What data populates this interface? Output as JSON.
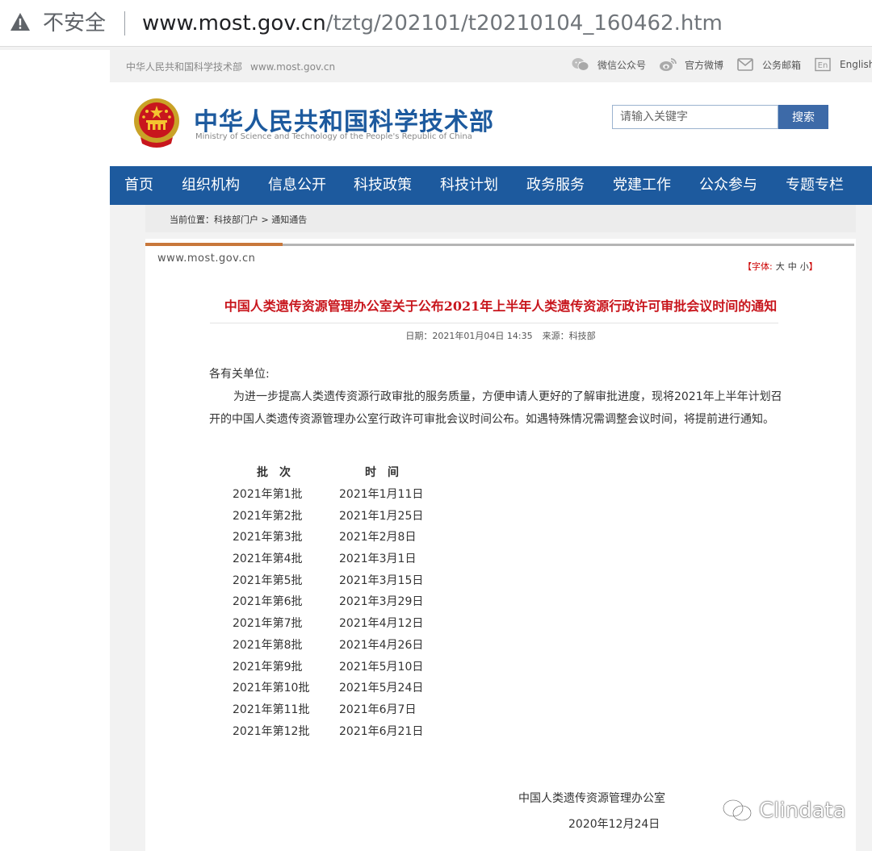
{
  "browser": {
    "security_label": "不安全",
    "url_host": "www.most.gov.cn",
    "url_path": "/tztg/202101/t20210104_160462.htm"
  },
  "topbar": {
    "site_name": "中华人民共和国科学技术部",
    "site_domain": "www.most.gov.cn",
    "links": [
      {
        "label": "微信公众号",
        "icon": "wechat-icon"
      },
      {
        "label": "官方微博",
        "icon": "weibo-icon"
      },
      {
        "label": "公务邮箱",
        "icon": "mail-icon"
      },
      {
        "label": "English",
        "icon": "english-icon"
      }
    ]
  },
  "header": {
    "title": "中华人民共和国科学技术部",
    "subtitle": "Ministry of Science and Technology of the People's Republic of China",
    "search_placeholder": "请输入关键字",
    "search_button": "搜索"
  },
  "nav": {
    "items": [
      "首页",
      "组织机构",
      "信息公开",
      "科技政策",
      "科技计划",
      "政务服务",
      "党建工作",
      "公众参与",
      "专题专栏"
    ]
  },
  "breadcrumb": "当前位置：科技部门户 > 通知通告",
  "article": {
    "site_mark": "www.most.gov.cn",
    "font_size": {
      "label": "字体:",
      "options": [
        "大",
        "中",
        "小"
      ]
    },
    "title": "中国人类遗传资源管理办公室关于公布2021年上半年人类遗传资源行政许可审批会议时间的通知",
    "date": "日期：2021年01月04日    14:35",
    "source": "来源：科技部",
    "salutation": "各有关单位:",
    "paragraph": "为进一步提高人类遗传资源行政审批的服务质量，方便申请人更好的了解审批进度，现将2021年上半年计划召开的中国人类遗传资源管理办公室行政许可审批会议时间公布。如遇特殊情况需调整会议时间，将提前进行通知。",
    "schedule_headers": [
      "批　次",
      "时　间"
    ],
    "schedule": [
      [
        "2021年第1批",
        "2021年1月11日"
      ],
      [
        "2021年第2批",
        "2021年1月25日"
      ],
      [
        "2021年第3批",
        "2021年2月8日"
      ],
      [
        "2021年第4批",
        "2021年3月1日"
      ],
      [
        "2021年第5批",
        "2021年3月15日"
      ],
      [
        "2021年第6批",
        "2021年3月29日"
      ],
      [
        "2021年第7批",
        "2021年4月12日"
      ],
      [
        "2021年第8批",
        "2021年4月26日"
      ],
      [
        "2021年第9批",
        "2021年5月10日"
      ],
      [
        "2021年第10批",
        "2021年5月24日"
      ],
      [
        "2021年第11批",
        "2021年6月7日"
      ],
      [
        "2021年第12批",
        "2021年6月21日"
      ]
    ],
    "signature_org": "中国人类遗传资源管理办公室",
    "signature_date": "2020年12月24日"
  },
  "watermark": "Clindata",
  "colors": {
    "nav_blue": "#1d5a9e",
    "title_red": "#c8161d",
    "accent_orange": "#c8773a"
  }
}
